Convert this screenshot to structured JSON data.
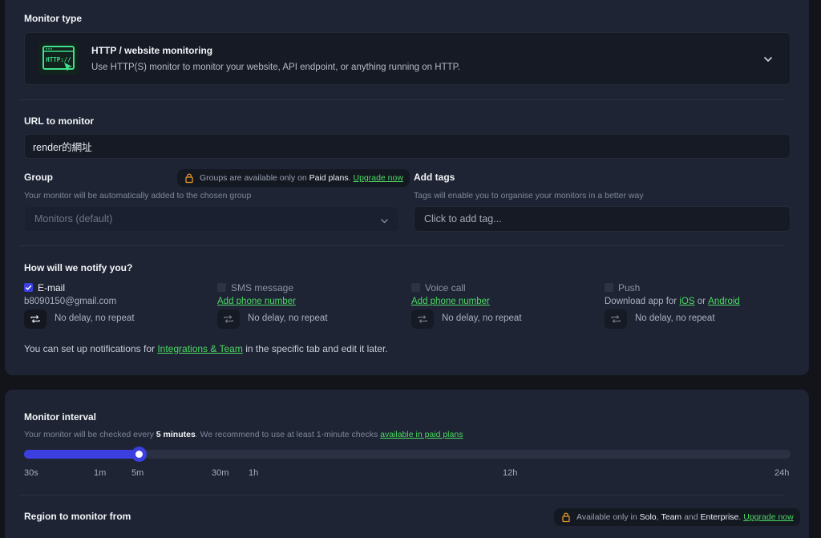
{
  "monitor_type": {
    "label": "Monitor type",
    "title": "HTTP / website monitoring",
    "description": "Use HTTP(S) monitor to monitor your website, API endpoint, or anything running on HTTP.",
    "icon_text": "HTTP://"
  },
  "url": {
    "label": "URL to monitor",
    "value": "render的網址"
  },
  "group": {
    "label": "Group",
    "description": "Your monitor will be automatically added to the chosen group",
    "selected": "Monitors (default)",
    "notice_prefix": "Groups are available only on",
    "notice_bold": "Paid plans",
    "notice_sep": ".",
    "upgrade": "Upgrade now"
  },
  "tags": {
    "label": "Add tags",
    "description": "Tags will enable you to organise your monitors in a better way",
    "placeholder": "Click to add tag..."
  },
  "notify": {
    "label": "How will we notify you?",
    "email": {
      "label": "E-mail",
      "detail": "b8090150@gmail.com",
      "repeat": "No delay, no repeat"
    },
    "sms": {
      "label": "SMS message",
      "link": "Add phone number",
      "repeat": "No delay, no repeat"
    },
    "voice": {
      "label": "Voice call",
      "link": "Add phone number",
      "repeat": "No delay, no repeat"
    },
    "push": {
      "label": "Push",
      "prefix": "Download app for",
      "ios": "iOS",
      "or": "or",
      "android": "Android",
      "repeat": "No delay, no repeat"
    },
    "footer_prefix": "You can set up notifications for",
    "footer_link": "Integrations & Team",
    "footer_suffix": "in the specific tab and edit it later."
  },
  "interval": {
    "label": "Monitor interval",
    "desc_prefix": "Your monitor will be checked every",
    "desc_bold": "5 minutes",
    "desc_mid": ". We recommend to use at least 1-minute checks",
    "desc_link": "available in paid plans",
    "ticks": [
      "30s",
      "1m",
      "5m",
      "30m",
      "1h",
      "12h",
      "24h"
    ],
    "selected": "5m"
  },
  "region": {
    "label": "Region to monitor from",
    "notice_prefix": "Available only in",
    "notice_b1": "Solo",
    "notice_sep1": ",",
    "notice_b2": "Team",
    "notice_and": "and",
    "notice_b3": "Enterprise",
    "notice_dot": ".",
    "upgrade": "Upgrade now"
  },
  "colors": {
    "accent": "#3b3fe0",
    "link": "#4cd964",
    "card": "#1e2433",
    "background": "#121419"
  }
}
